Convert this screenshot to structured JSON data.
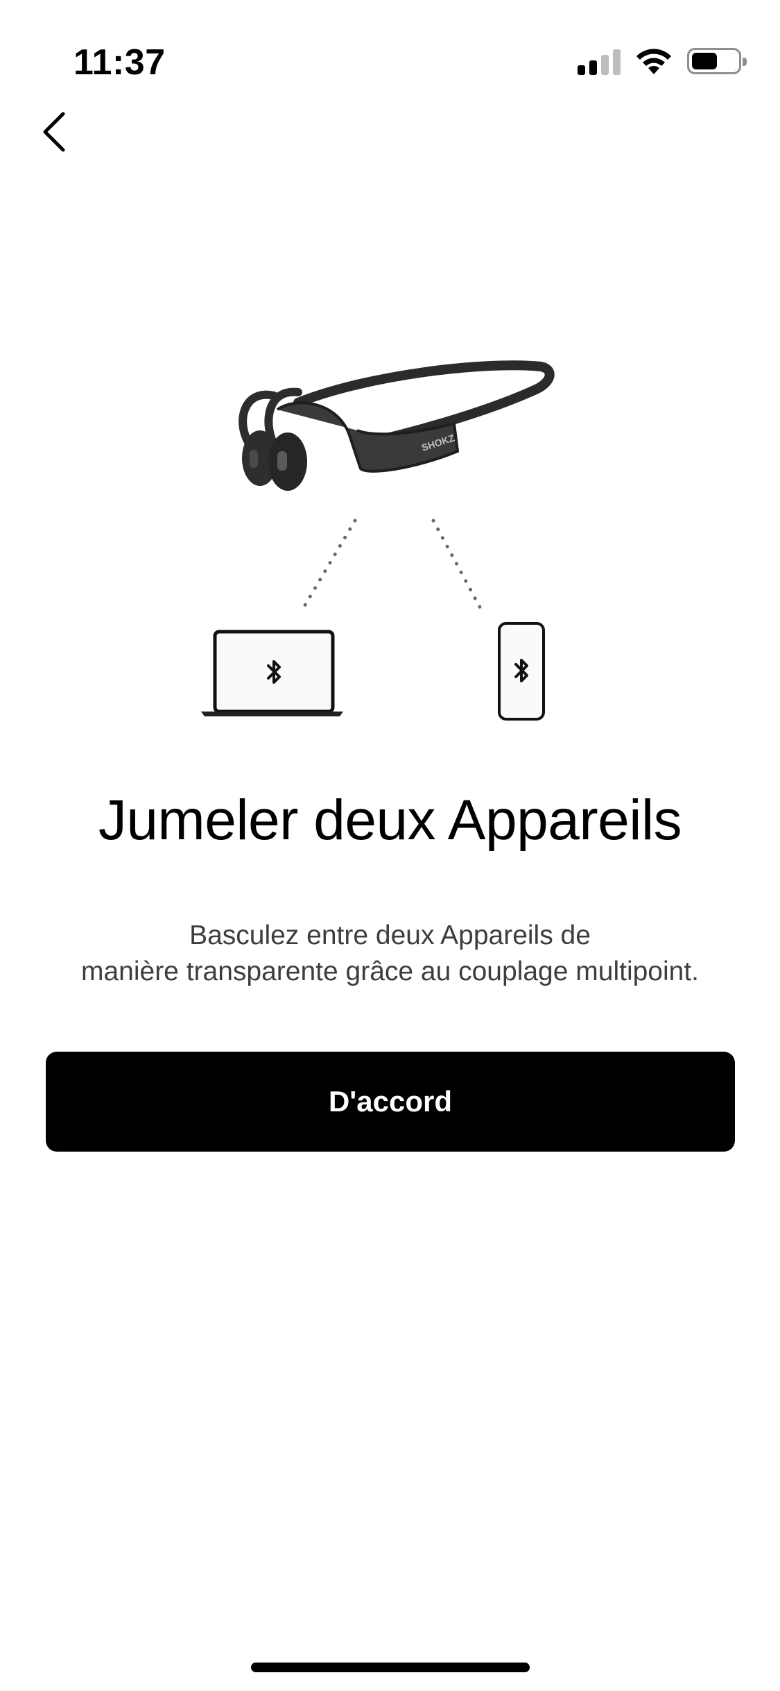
{
  "status_bar": {
    "time": "11:37",
    "signal_bars_filled": 2,
    "signal_bars_total": 4,
    "battery_level": 0.55
  },
  "nav": {
    "back_icon": "chevron-left-icon"
  },
  "illustration": {
    "headphones_logo": "SHOKZ",
    "laptop_icon": "bluetooth-icon",
    "phone_icon": "bluetooth-icon"
  },
  "content": {
    "title": "Jumeler deux Appareils",
    "description_line1": "Basculez entre deux Appareils de",
    "description_line2": "manière transparente grâce au couplage multipoint."
  },
  "actions": {
    "confirm_label": "D'accord"
  },
  "colors": {
    "background": "#ffffff",
    "button": "#000000",
    "button_text": "#ffffff",
    "description_text": "#3d3d3d"
  }
}
